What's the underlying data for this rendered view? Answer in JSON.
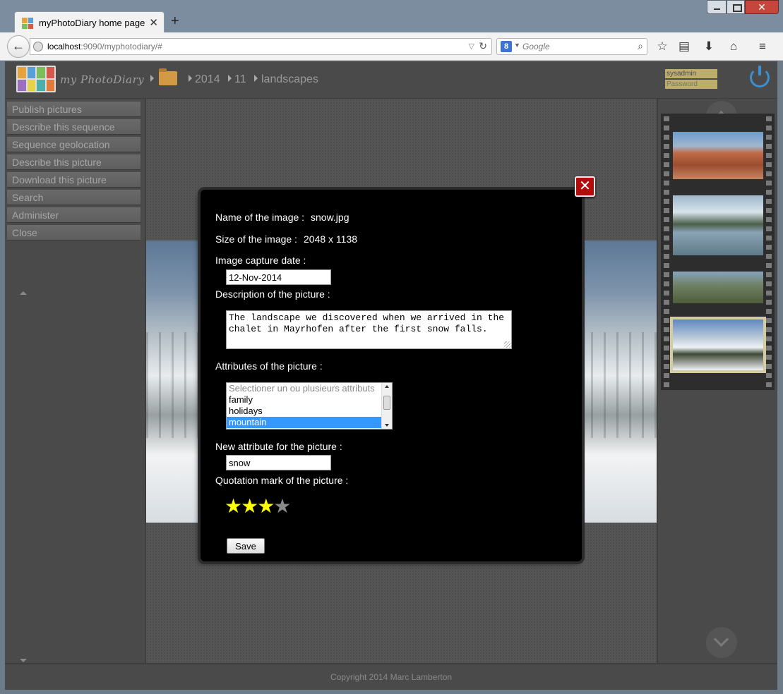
{
  "browser": {
    "tab_title": "myPhotoDiary home page",
    "tab_close": "✕",
    "new_tab": "+",
    "url_host": "localhost",
    "url_path": ":9090/myphotodiary/#",
    "search_placeholder": "Google",
    "search_engine_glyph": "8"
  },
  "app": {
    "logo_text": "my PhotoDiary",
    "breadcrumb": [
      "2014",
      "11",
      "landscapes"
    ],
    "login": {
      "username": "sysadmin",
      "password_placeholder": "Password"
    },
    "menu": [
      "Publish pictures",
      "Describe this sequence",
      "Sequence geolocation",
      "Describe this picture",
      "Download this picture",
      "Search",
      "Administer",
      "Close"
    ],
    "footer": "Copyright 2014 Marc Lamberton"
  },
  "dialog": {
    "name_label": "Name of the image :",
    "name_value": "snow.jpg",
    "size_label": "Size of the image :",
    "size_value": "2048 x 1138",
    "date_label": "Image capture date :",
    "date_value": "12-Nov-2014",
    "description_label": "Description of the picture :",
    "description_value": "The landscape we discovered when we arrived in the chalet in Mayrhofen after the first snow falls.",
    "attributes_label": "Attributes of the picture :",
    "attributes_options": [
      "Selectioner un ou plusieurs attributs",
      "family",
      "holidays",
      "mountain"
    ],
    "attributes_selected": "mountain",
    "new_attribute_label": "New attribute for the picture :",
    "new_attribute_value": "snow",
    "rating_label": "Quotation mark of the picture :",
    "rating": 3,
    "rating_max": 4,
    "save_label": "Save",
    "close_glyph": "✕"
  },
  "colors": {
    "star_on": "#ffff00",
    "star_off": "#8a8a8a",
    "selection": "#3399ff",
    "close_red": "#b20d0d"
  }
}
